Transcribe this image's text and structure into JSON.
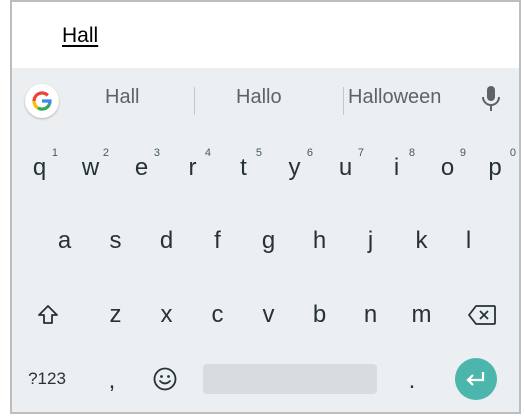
{
  "input": {
    "typed_text": "Hall"
  },
  "suggestions": {
    "left": "Hall",
    "center": "Hallo",
    "right": "Halloween",
    "google_icon": "google-g-icon",
    "mic_icon": "mic-icon"
  },
  "rows": {
    "r1": [
      {
        "label": "q",
        "hint": "1"
      },
      {
        "label": "w",
        "hint": "2"
      },
      {
        "label": "e",
        "hint": "3"
      },
      {
        "label": "r",
        "hint": "4"
      },
      {
        "label": "t",
        "hint": "5"
      },
      {
        "label": "y",
        "hint": "6"
      },
      {
        "label": "u",
        "hint": "7"
      },
      {
        "label": "i",
        "hint": "8"
      },
      {
        "label": "o",
        "hint": "9"
      },
      {
        "label": "p",
        "hint": "0"
      }
    ],
    "r2": [
      {
        "label": "a"
      },
      {
        "label": "s"
      },
      {
        "label": "d"
      },
      {
        "label": "f"
      },
      {
        "label": "g"
      },
      {
        "label": "h"
      },
      {
        "label": "j"
      },
      {
        "label": "k"
      },
      {
        "label": "l"
      }
    ],
    "r3": [
      {
        "label": "z"
      },
      {
        "label": "x"
      },
      {
        "label": "c"
      },
      {
        "label": "v"
      },
      {
        "label": "b"
      },
      {
        "label": "n"
      },
      {
        "label": "m"
      }
    ]
  },
  "bottom_row": {
    "symbols": "?123",
    "comma": ",",
    "period": "."
  },
  "colors": {
    "accent": "#4db6ac",
    "keyboard_bg": "#eceff1",
    "key_text": "#263238"
  }
}
